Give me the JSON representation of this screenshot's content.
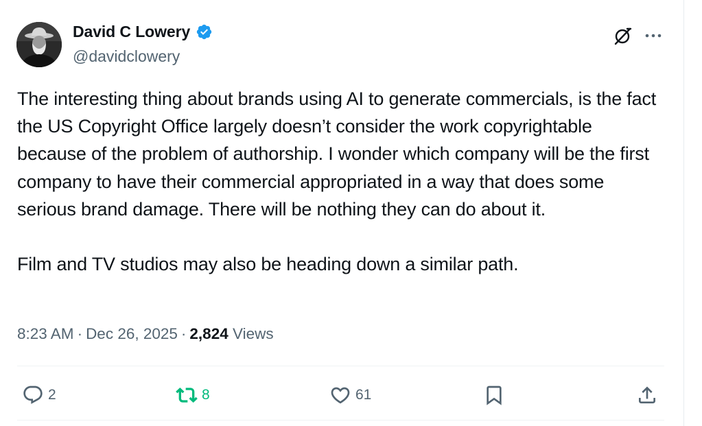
{
  "author": {
    "display_name": "David C Lowery",
    "handle": "@davidclowery",
    "verified": true
  },
  "tweet": {
    "paragraphs": [
      "The interesting thing about brands using AI to generate commercials, is the fact the US Copyright Office largely doesn’t consider the work copyrightable because of the problem of authorship. I wonder which company will be the first company to have their commercial appropriated in a way that does some serious brand damage. There will be nothing they can do about it.",
      "Film and TV studios may also be heading down a similar path."
    ]
  },
  "meta": {
    "time": "8:23 AM",
    "separator": "·",
    "date": "Dec 26, 2025",
    "views_count": "2,824",
    "views_label": "Views"
  },
  "actions": {
    "replies": "2",
    "retweets": "8",
    "likes": "61"
  },
  "icons": {
    "verified": "verified-badge-icon",
    "grok": "grok-icon",
    "more": "more-icon",
    "reply": "reply-icon",
    "retweet": "retweet-icon",
    "like": "heart-icon",
    "bookmark": "bookmark-icon",
    "share": "share-icon"
  },
  "colors": {
    "text": "#0f1419",
    "secondary": "#536471",
    "verified": "#1d9bf0",
    "retweet": "#00ba7c",
    "divider": "#eff3f4"
  }
}
